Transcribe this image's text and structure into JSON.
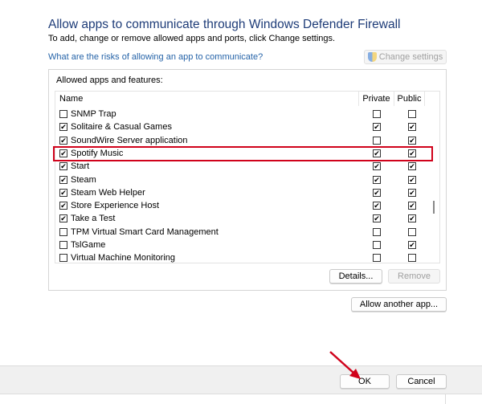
{
  "title": "Allow apps to communicate through Windows Defender Firewall",
  "subtitle": "To add, change or remove allowed apps and ports, click Change settings.",
  "risks_link": "What are the risks of allowing an app to communicate?",
  "change_settings": "Change settings",
  "group_label": "Allowed apps and features:",
  "columns": {
    "name": "Name",
    "private": "Private",
    "public": "Public"
  },
  "apps": [
    {
      "name": "SNMP Trap",
      "enabled": false,
      "private": false,
      "public": false
    },
    {
      "name": "Solitaire & Casual Games",
      "enabled": true,
      "private": true,
      "public": true
    },
    {
      "name": "SoundWire Server application",
      "enabled": true,
      "private": false,
      "public": true
    },
    {
      "name": "Spotify Music",
      "enabled": true,
      "private": true,
      "public": true,
      "highlighted": true
    },
    {
      "name": "Start",
      "enabled": true,
      "private": true,
      "public": true
    },
    {
      "name": "Steam",
      "enabled": true,
      "private": true,
      "public": true
    },
    {
      "name": "Steam Web Helper",
      "enabled": true,
      "private": true,
      "public": true
    },
    {
      "name": "Store Experience Host",
      "enabled": true,
      "private": true,
      "public": true
    },
    {
      "name": "Take a Test",
      "enabled": true,
      "private": true,
      "public": true
    },
    {
      "name": "TPM Virtual Smart Card Management",
      "enabled": false,
      "private": false,
      "public": false
    },
    {
      "name": "TslGame",
      "enabled": false,
      "private": false,
      "public": true
    },
    {
      "name": "Virtual Machine Monitoring",
      "enabled": false,
      "private": false,
      "public": false
    }
  ],
  "buttons": {
    "details": "Details...",
    "remove": "Remove",
    "allow_another": "Allow another app...",
    "ok": "OK",
    "cancel": "Cancel"
  },
  "colors": {
    "highlight": "#d0021b",
    "annotation_arrow": "#d0021b"
  }
}
